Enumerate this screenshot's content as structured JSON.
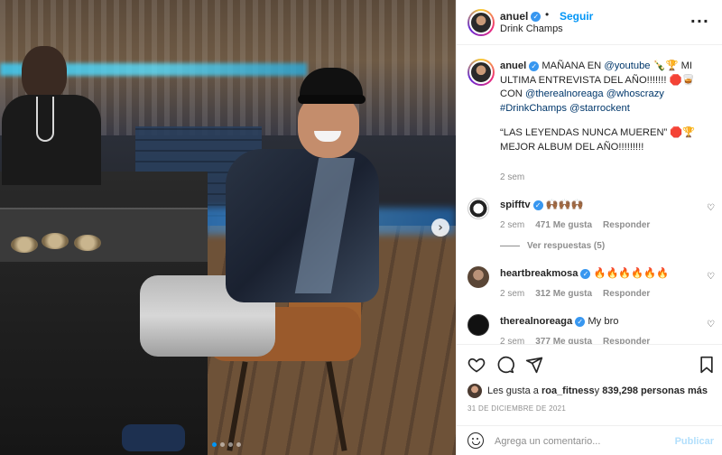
{
  "post": {
    "username": "anuel",
    "follow_label": "Seguir",
    "dot": "•",
    "location": "Drink Champs",
    "more": "···"
  },
  "caption": {
    "username": "anuel",
    "t1": " MAÑANA EN ",
    "youtube": "@youtube",
    "t2": " 🍾🏆 MI ULTIMA ENTREVISTA DEL AÑO!!!!!!! 🛑🥃 CON ",
    "noreaga": "@therealnoreaga",
    "whoscrazy": "@whoscrazy",
    "drinkchamps": "#DrinkChamps",
    "starrocket": "@starrockent",
    "quote": "“LAS LEYENDAS NUNCA MUEREN” 🛑🏆 MEJOR ALBUM DEL AÑO!!!!!!!!!",
    "time": "2 sem"
  },
  "comments": [
    {
      "username": "spifftv",
      "text": "🙌🏾🙌🏾🙌🏾",
      "time": "2 sem",
      "likes": "471 Me gusta",
      "reply": "Responder"
    },
    {
      "username": "heartbreakmosa",
      "text": "🔥🔥🔥🔥🔥🔥",
      "time": "2 sem",
      "likes": "312 Me gusta",
      "reply": "Responder"
    },
    {
      "username": "therealnoreaga",
      "text": "My bro",
      "time": "2 sem",
      "likes": "377 Me gusta",
      "reply": "Responder"
    }
  ],
  "view_replies": "Ver respuestas (5)",
  "likes": {
    "prefix": "Les gusta a ",
    "user": "roa_fitness",
    "middle": " y ",
    "count": "839,298 personas más"
  },
  "date": "31 DE DICIEMBRE DE 2021",
  "add_comment": {
    "placeholder": "Agrega un comentario...",
    "post_label": "Publicar"
  },
  "colors": {
    "link": "#00376b",
    "accent": "#0095f6",
    "verified": "#3897f0",
    "muted": "#8e8e8e"
  },
  "icons": {
    "like": "heart-icon",
    "comment": "comment-icon",
    "share": "send-icon",
    "save": "bookmark-icon",
    "emoji": "emoji-icon",
    "next": "chevron-right-icon"
  }
}
